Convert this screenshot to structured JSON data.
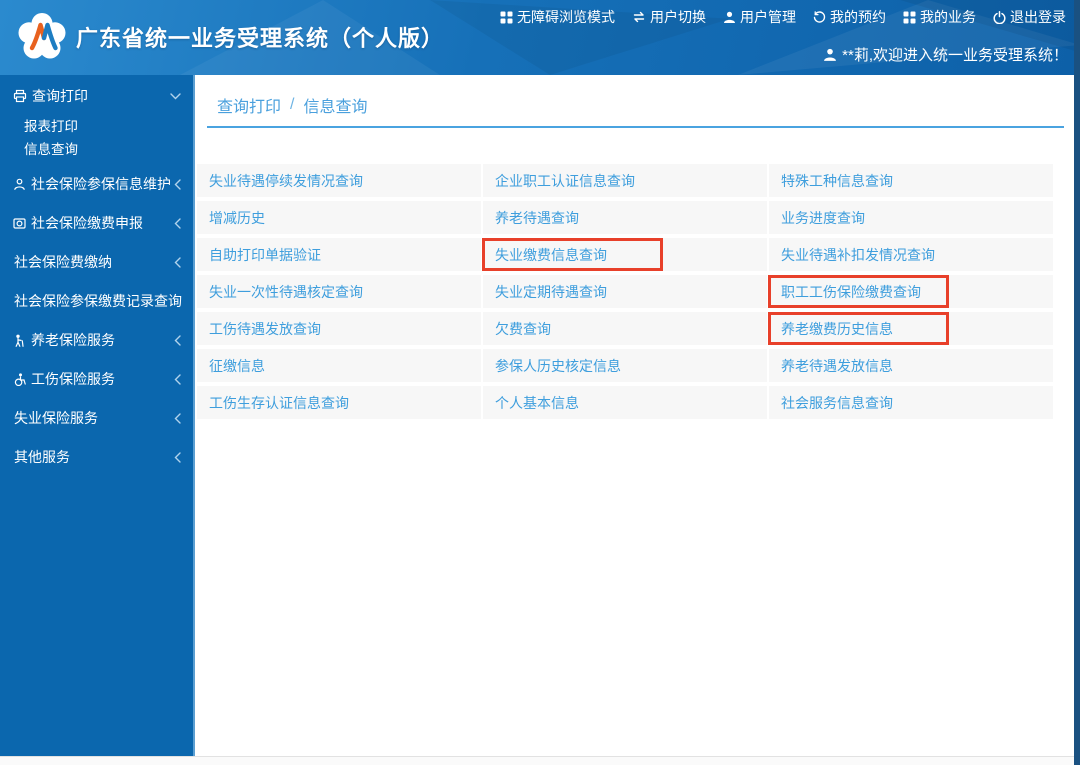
{
  "header": {
    "title": "广东省统一业务受理系统（个人版）",
    "welcome": "**莉,欢迎进入统一业务受理系统！",
    "top_menu": [
      {
        "label": "无障碍浏览模式",
        "icon": "accessibility-grid-icon"
      },
      {
        "label": "用户切换",
        "icon": "switch-user-icon"
      },
      {
        "label": "用户管理",
        "icon": "user-icon"
      },
      {
        "label": "我的预约",
        "icon": "history-icon"
      },
      {
        "label": "我的业务",
        "icon": "grid-icon"
      },
      {
        "label": "退出登录",
        "icon": "power-icon"
      }
    ]
  },
  "sidebar": {
    "items": [
      {
        "label": "查询打印",
        "icon": "printer-icon",
        "state": "expanded",
        "children": [
          "报表打印",
          "信息查询"
        ]
      },
      {
        "label": "社会保险参保信息维护",
        "icon": "person-icon",
        "state": "collapsed"
      },
      {
        "label": "社会保险缴费申报",
        "icon": "declare-icon",
        "state": "collapsed"
      },
      {
        "label": "社会保险费缴纳",
        "state": "collapsed"
      },
      {
        "label": "社会保险参保缴费记录查询",
        "state": "collapsed"
      },
      {
        "label": "养老保险服务",
        "icon": "elderly-icon",
        "state": "collapsed"
      },
      {
        "label": "工伤保险服务",
        "icon": "wheelchair-icon",
        "state": "collapsed"
      },
      {
        "label": "失业保险服务",
        "state": "collapsed"
      },
      {
        "label": "其他服务",
        "state": "collapsed"
      }
    ]
  },
  "breadcrumb": {
    "parent": "查询打印",
    "separator": "/",
    "current": "信息查询"
  },
  "links_grid": {
    "rows": [
      [
        {
          "label": "失业待遇停续发情况查询"
        },
        {
          "label": "企业职工认证信息查询"
        },
        {
          "label": "特殊工种信息查询"
        }
      ],
      [
        {
          "label": "增减历史"
        },
        {
          "label": "养老待遇查询"
        },
        {
          "label": "业务进度查询"
        }
      ],
      [
        {
          "label": "自助打印单据验证"
        },
        {
          "label": "失业缴费信息查询",
          "highlighted": true
        },
        {
          "label": "失业待遇补扣发情况查询"
        }
      ],
      [
        {
          "label": "失业一次性待遇核定查询"
        },
        {
          "label": "失业定期待遇查询"
        },
        {
          "label": "职工工伤保险缴费查询",
          "highlighted": true
        }
      ],
      [
        {
          "label": "工伤待遇发放查询"
        },
        {
          "label": "欠费查询"
        },
        {
          "label": "养老缴费历史信息",
          "highlighted": true
        }
      ],
      [
        {
          "label": "征缴信息"
        },
        {
          "label": "参保人历史核定信息"
        },
        {
          "label": "养老待遇发放信息"
        }
      ],
      [
        {
          "label": "工伤生存认证信息查询"
        },
        {
          "label": "个人基本信息"
        },
        {
          "label": "社会服务信息查询"
        }
      ]
    ]
  },
  "colors": {
    "header_blue_light": "#2b8ace",
    "header_blue_dark": "#0d60a8",
    "sidebar_blue": "#0b67ae",
    "link_blue": "#3e9edd",
    "breadcrumb_underline": "#4aa3e0",
    "cell_background": "#f7f7f7",
    "highlight_red": "#e8402a"
  }
}
